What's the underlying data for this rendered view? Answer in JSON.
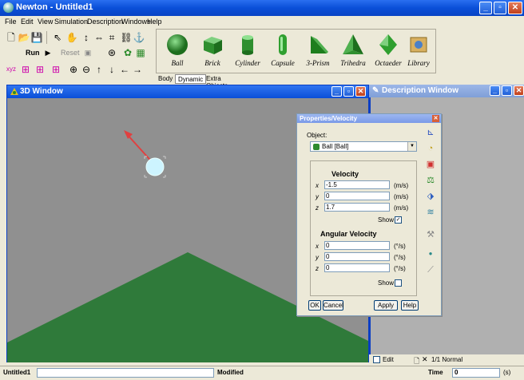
{
  "app": {
    "title": "Newton - Untitled1"
  },
  "menu": [
    "File",
    "Edit",
    "View",
    "Simulation",
    "Description",
    "Windows",
    "Help"
  ],
  "toolbar": {
    "run_label": "Run",
    "reset_label": "Reset"
  },
  "objects": [
    "Ball",
    "Brick",
    "Cylinder",
    "Capsule",
    "3-Prism",
    "Trihedra",
    "Octaeder",
    "Library"
  ],
  "tabs": [
    "Body",
    "Dynamic",
    "Extra Objects"
  ],
  "window3d": {
    "title": "3D Window"
  },
  "description": {
    "title": "Description Window",
    "edit_label": "Edit",
    "page_status": "1/1 Normal"
  },
  "properties": {
    "title": "Properties/Velocity",
    "object_label": "Object:",
    "object_value": "Ball  [Ball]",
    "velocity": {
      "heading": "Velocity",
      "rows": [
        {
          "axis": "x",
          "value": "-1.5",
          "unit": "(m/s)"
        },
        {
          "axis": "y",
          "value": "0",
          "unit": "(m/s)"
        },
        {
          "axis": "z",
          "value": "1.7",
          "unit": "(m/s)"
        }
      ],
      "show_label": "Show",
      "show_checked": true
    },
    "angular": {
      "heading": "Angular Velocity",
      "rows": [
        {
          "axis": "x",
          "value": "0",
          "unit": "(°/s)"
        },
        {
          "axis": "y",
          "value": "0",
          "unit": "(°/s)"
        },
        {
          "axis": "z",
          "value": "0",
          "unit": "(°/s)"
        }
      ],
      "show_label": "Show",
      "show_checked": false
    },
    "buttons": {
      "ok": "OK",
      "cancel": "Cancel",
      "apply": "Apply",
      "help": "Help"
    }
  },
  "status": {
    "doc": "Untitled1",
    "state": "Modified",
    "time_label": "Time",
    "time_value": "0",
    "time_unit": "(s)"
  },
  "colors": {
    "ground": "#2f7a3a",
    "sky": "#909090",
    "ball": "#cdf4ff",
    "arrow": "#e04040",
    "title_blue": "#0a4fd8"
  }
}
